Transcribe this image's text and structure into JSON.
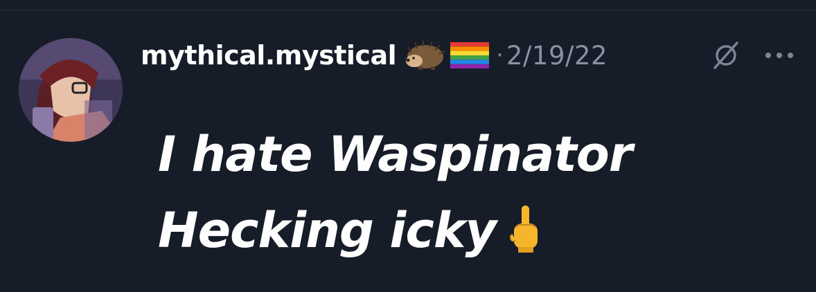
{
  "post": {
    "username": "mythical.mystical",
    "badges": [
      "hedgehog-emoji",
      "rainbow-flag-emoji"
    ],
    "separator": "·",
    "date": "2/19/22",
    "lines": [
      "I hate Waspinator",
      "Hecking icky"
    ],
    "trailing_emoji": "middle-finger-emoji"
  },
  "colors": {
    "background": "#161c28",
    "text_primary": "#ffffff",
    "text_secondary": "#8a92a0"
  }
}
